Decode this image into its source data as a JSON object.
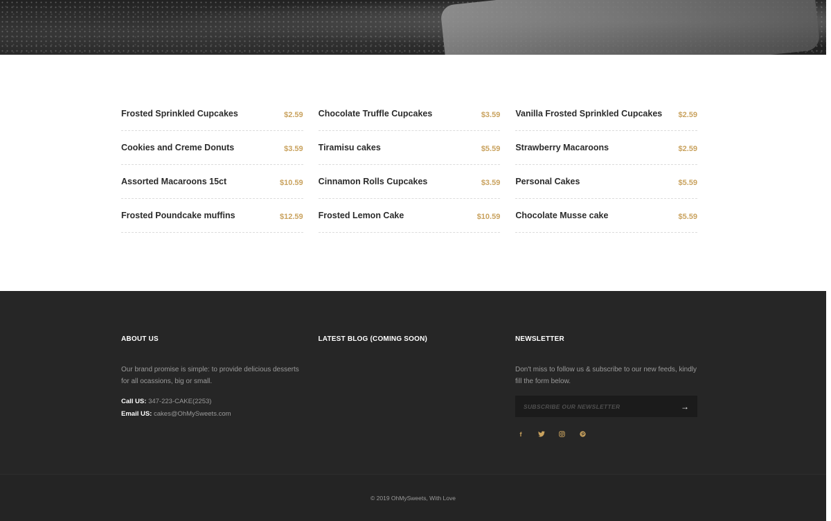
{
  "menu": {
    "columns": [
      [
        {
          "name": "Frosted Sprinkled Cupcakes",
          "price": "$2.59"
        },
        {
          "name": "Cookies and Creme Donuts",
          "price": "$3.59"
        },
        {
          "name": "Assorted Macaroons 15ct",
          "price": "$10.59"
        },
        {
          "name": "Frosted Poundcake muffins",
          "price": "$12.59"
        }
      ],
      [
        {
          "name": "Chocolate Truffle Cupcakes",
          "price": "$3.59"
        },
        {
          "name": "Tiramisu cakes",
          "price": "$5.59"
        },
        {
          "name": "Cinnamon Rolls Cupcakes",
          "price": "$3.59"
        },
        {
          "name": "Frosted Lemon Cake",
          "price": "$10.59"
        }
      ],
      [
        {
          "name": "Vanilla Frosted Sprinkled Cupcakes",
          "price": "$2.59"
        },
        {
          "name": "Strawberry Macaroons",
          "price": "$2.59"
        },
        {
          "name": "Personal Cakes",
          "price": "$5.59"
        },
        {
          "name": "Chocolate Musse cake",
          "price": "$5.59"
        }
      ]
    ]
  },
  "footer": {
    "about": {
      "heading": "ABOUT US",
      "text": "Our brand promise is simple: to provide delicious desserts for all ocassions, big or small.",
      "call_label": "Call US:",
      "call_value": "347-223-CAKE(2253)",
      "email_label": "Email US:",
      "email_value": "cakes@OhMySweets.com"
    },
    "blog": {
      "heading": "LATEST BLOG (COMING SOON)"
    },
    "newsletter": {
      "heading": "NEWSLETTER",
      "text": "Don't miss to follow us & subscribe to our new feeds, kindly fill the form below.",
      "placeholder": "SUBSCRIBE OUR NEWSLETTER",
      "submit_glyph": "→"
    },
    "socials": [
      {
        "name": "facebook",
        "glyph": "f"
      },
      {
        "name": "twitter",
        "glyph": "twitter-bird"
      },
      {
        "name": "instagram",
        "glyph": "instagram-camera"
      },
      {
        "name": "pinterest",
        "glyph": "pinterest-p"
      }
    ],
    "copyright": "© 2019 OhMySweets, With Love"
  },
  "colors": {
    "accent": "#c9a25e",
    "footer_bg": "#262626",
    "text_dark": "#2b2b2b"
  }
}
